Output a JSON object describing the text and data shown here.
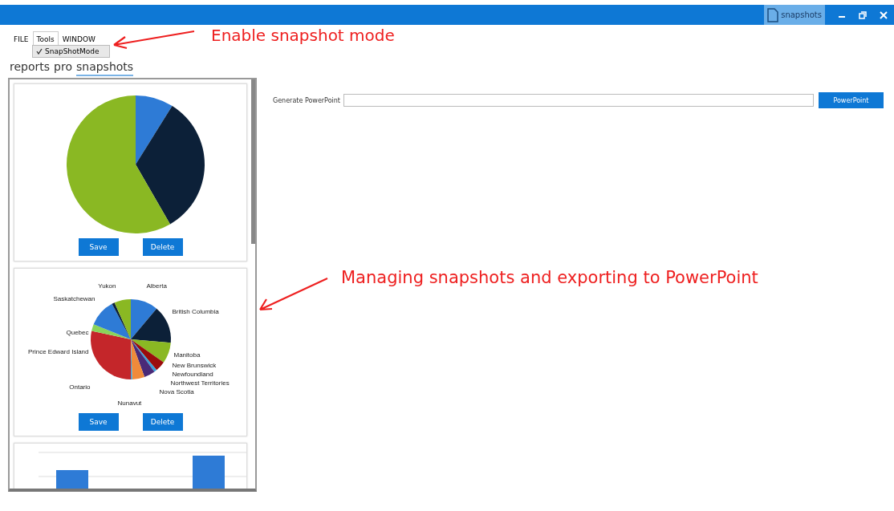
{
  "title_bar": {
    "document_tab": "snapshots",
    "controls": [
      {
        "kind": "minimize"
      },
      {
        "kind": "restore"
      },
      {
        "kind": "close"
      }
    ]
  },
  "menu": {
    "items": [
      {
        "label": "FILE",
        "selected": false
      },
      {
        "label": "Tools",
        "selected": true
      },
      {
        "label": "WINDOW",
        "selected": false
      }
    ],
    "dropdown": [
      {
        "label": "SnapShotMode",
        "checked": true
      }
    ]
  },
  "tabs": [
    {
      "label": "reports",
      "selected": false
    },
    {
      "label": "pro",
      "selected": false
    },
    {
      "label": "snapshots",
      "selected": true
    }
  ],
  "snapshots": [
    {
      "kind": "pie",
      "buttons": [
        "Save",
        "Delete"
      ]
    },
    {
      "kind": "pie",
      "labels": [
        "Yukon",
        "Alberta",
        "Saskatchewan",
        "British Columbia",
        "Quebec",
        "Prince Edward Island",
        "Manitoba",
        "New Brunswick",
        "Newfoundland",
        "Northwest Territories",
        "Nova Scotia",
        "Ontario",
        "Nunavut"
      ],
      "buttons": [
        "Save",
        "Delete"
      ]
    },
    {
      "kind": "bar"
    }
  ],
  "export": {
    "label": "Generate PowerPoint",
    "button": "PowerPoint"
  },
  "annotations": [
    {
      "kind": "menu",
      "text": "Enable snapshot mode"
    },
    {
      "kind": "panel",
      "text": "Managing snapshots and exporting to PowerPoint"
    }
  ]
}
